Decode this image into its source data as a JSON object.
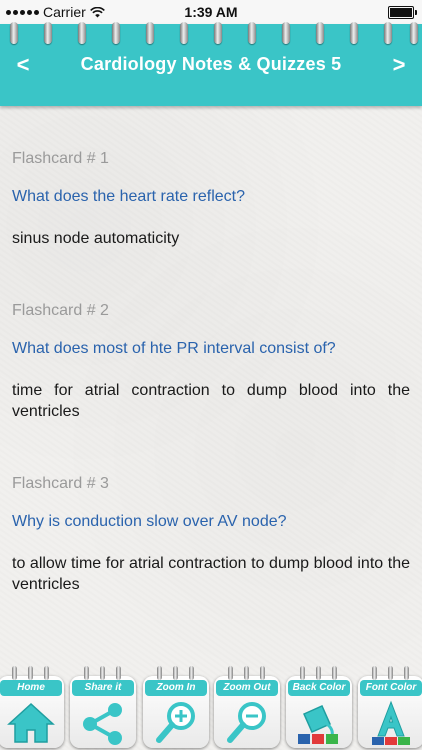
{
  "status_bar": {
    "carrier": "Carrier",
    "time": "1:39 AM"
  },
  "header": {
    "title": "Cardiology Notes & Quizzes 5",
    "prev": "<",
    "next": ">"
  },
  "flashcards": [
    {
      "label": "Flashcard # 1",
      "question": "What does the heart rate reflect?",
      "answer": "sinus node automaticity"
    },
    {
      "label": "Flashcard # 2",
      "question": "What does most of hte PR interval consist of?",
      "answer": "time for atrial contraction to dump blood into the ventricles"
    },
    {
      "label": "Flashcard # 3",
      "question": "Why is conduction slow over AV node?",
      "answer": "to allow time for atrial contraction to dump blood into the ventricles"
    }
  ],
  "toolbar": {
    "home": "Home",
    "share": "Share it",
    "zoom_in": "Zoom In",
    "zoom_out": "Zoom Out",
    "back_color": "Back Color",
    "font_color": "Font Color"
  },
  "colors": {
    "accent": "#3ac5c7",
    "question": "#2a63ad",
    "label": "#9a9a9a"
  }
}
